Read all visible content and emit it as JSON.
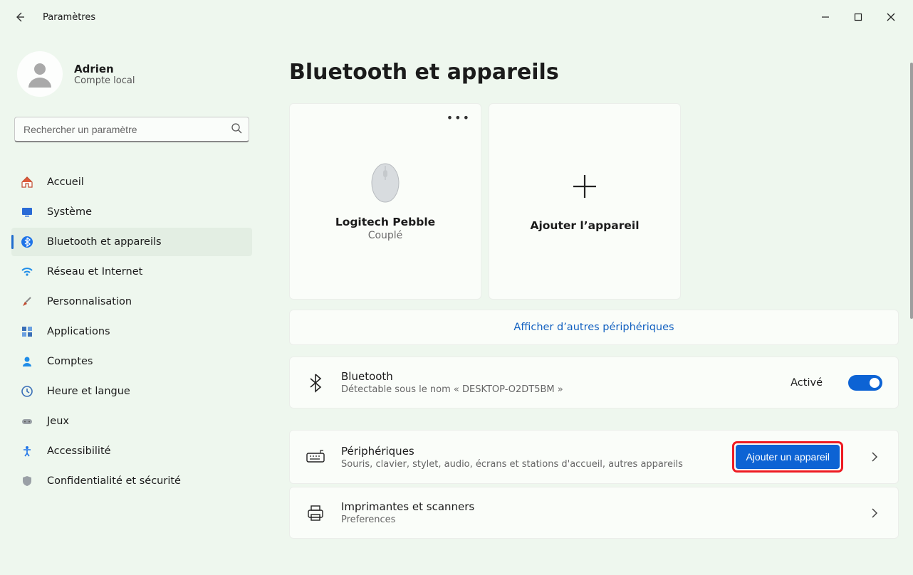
{
  "window": {
    "title": "Paramètres"
  },
  "user": {
    "name": "Adrien",
    "subtitle": "Compte local"
  },
  "search": {
    "placeholder": "Rechercher un paramètre"
  },
  "sidebar": {
    "items": [
      {
        "label": "Accueil"
      },
      {
        "label": "Système"
      },
      {
        "label": "Bluetooth et appareils"
      },
      {
        "label": "Réseau et Internet"
      },
      {
        "label": "Personnalisation"
      },
      {
        "label": "Applications"
      },
      {
        "label": "Comptes"
      },
      {
        "label": "Heure et langue"
      },
      {
        "label": "Jeux"
      },
      {
        "label": "Accessibilité"
      },
      {
        "label": "Confidentialité et sécurité"
      }
    ]
  },
  "page": {
    "title": "Bluetooth et appareils",
    "device": {
      "name": "Logitech Pebble",
      "status": "Couplé"
    },
    "add_device_card": "Ajouter l’appareil",
    "show_more": "Afficher d’autres périphériques",
    "bluetooth": {
      "title": "Bluetooth",
      "subtitle": "Détectable sous le nom « DESKTOP-O2DT5BM »",
      "status": "Activé"
    },
    "devices_row": {
      "title": "Périphériques",
      "subtitle": "Souris, clavier, stylet, audio, écrans et stations d'accueil, autres appareils",
      "button": "Ajouter un appareil"
    },
    "printers_row": {
      "title": "Imprimantes et scanners",
      "subtitle": "Preferences"
    }
  }
}
